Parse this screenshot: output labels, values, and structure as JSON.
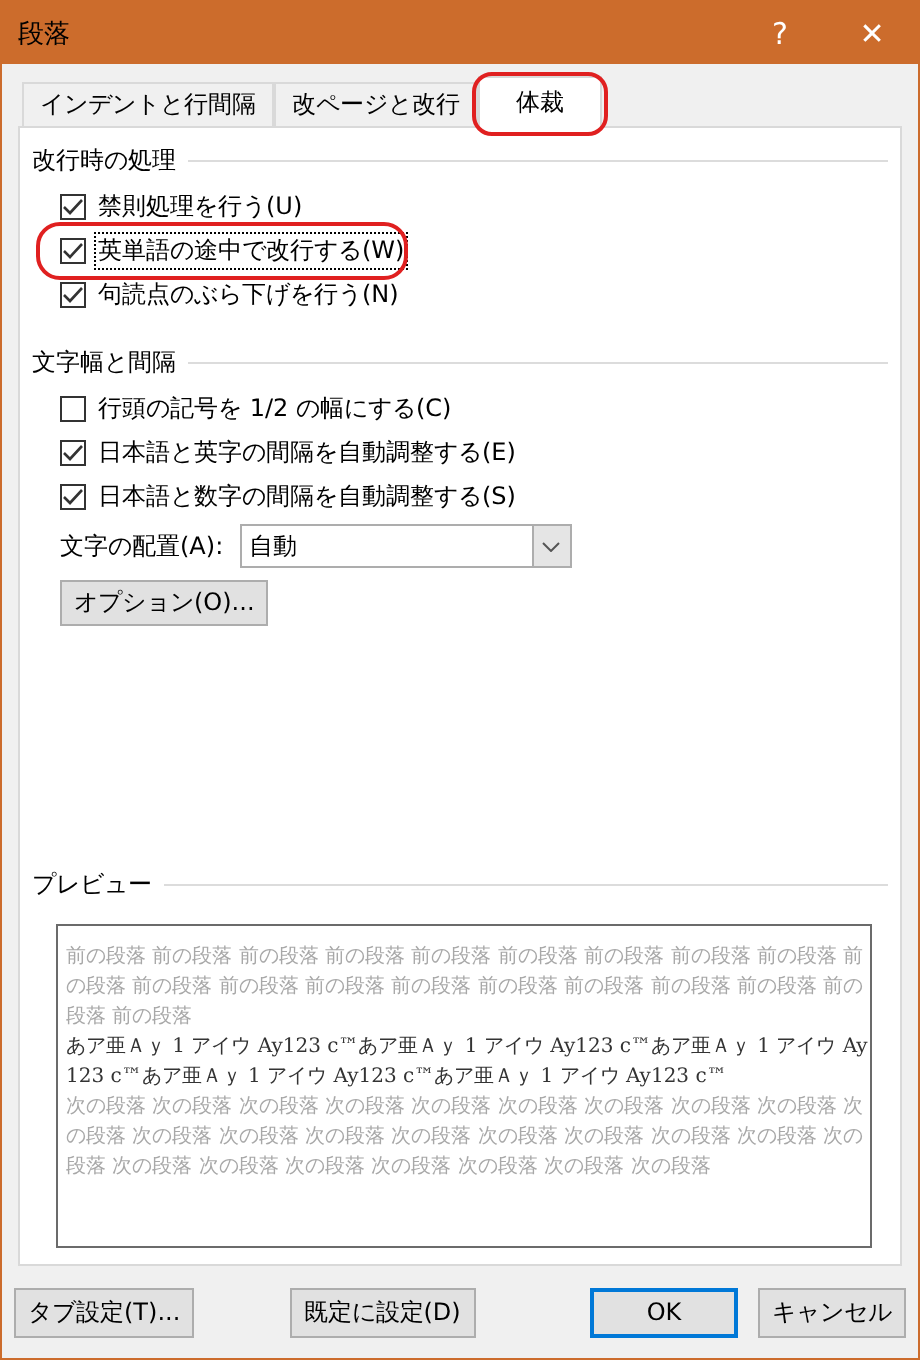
{
  "window": {
    "title": "段落",
    "help": "?",
    "close": "✕"
  },
  "tabs": [
    {
      "label": "インデントと行間隔",
      "selected": false,
      "highlighted": false
    },
    {
      "label": "改ページと改行",
      "selected": false,
      "highlighted": false
    },
    {
      "label": "体裁",
      "selected": true,
      "highlighted": true
    }
  ],
  "sections": [
    {
      "title": "改行時の処理",
      "checkboxes": [
        {
          "label": "禁則処理を行う(U)",
          "checked": true,
          "focused": false,
          "highlighted": false
        },
        {
          "label": "英単語の途中で改行する(W)",
          "checked": true,
          "focused": true,
          "highlighted": true
        },
        {
          "label": "句読点のぶら下げを行う(N)",
          "checked": true,
          "focused": false,
          "highlighted": false
        }
      ]
    },
    {
      "title": "文字幅と間隔",
      "checkboxes": [
        {
          "label": "行頭の記号を 1/2 の幅にする(C)",
          "checked": false,
          "focused": false,
          "highlighted": false
        },
        {
          "label": "日本語と英字の間隔を自動調整する(E)",
          "checked": true,
          "focused": false,
          "highlighted": false
        },
        {
          "label": "日本語と数字の間隔を自動調整する(S)",
          "checked": true,
          "focused": false,
          "highlighted": false
        }
      ]
    }
  ],
  "alignment": {
    "label": "文字の配置(A):",
    "value": "自動"
  },
  "options_button": "オプション(O)...",
  "preview": {
    "title": "プレビュー",
    "paragraphs": [
      {
        "kind": "previous",
        "text": "前の段落 前の段落 前の段落 前の段落 前の段落 前の段落 前の段落 前の段落 前の段落 前の段落 前の段落 前の段落 前の段落 前の段落 前の段落 前の段落 前の段落 前の段落 前の段落 前の段落"
      },
      {
        "kind": "current",
        "text": "あア亜Ａｙ 1 アイウ Ay123 c™あア亜Ａｙ 1 アイウ Ay123 c™あア亜Ａｙ 1 アイウ Ay123 c™あア亜Ａｙ 1 アイウ Ay123 c™あア亜Ａｙ 1 アイウ Ay123 c™"
      },
      {
        "kind": "next",
        "text": "次の段落 次の段落 次の段落 次の段落 次の段落 次の段落 次の段落 次の段落 次の段落 次の段落 次の段落 次の段落 次の段落 次の段落 次の段落 次の段落 次の段落 次の段落 次の段落 次の段落 次の段落 次の段落 次の段落 次の段落 次の段落 次の段落"
      }
    ]
  },
  "buttons": [
    {
      "label": "タブ設定(T)...",
      "kind": "left",
      "default": false
    },
    {
      "label": "既定に設定(D)",
      "kind": "center",
      "default": false
    },
    {
      "label": "OK",
      "kind": "right",
      "default": true
    },
    {
      "label": "キャンセル",
      "kind": "right",
      "default": false
    }
  ]
}
